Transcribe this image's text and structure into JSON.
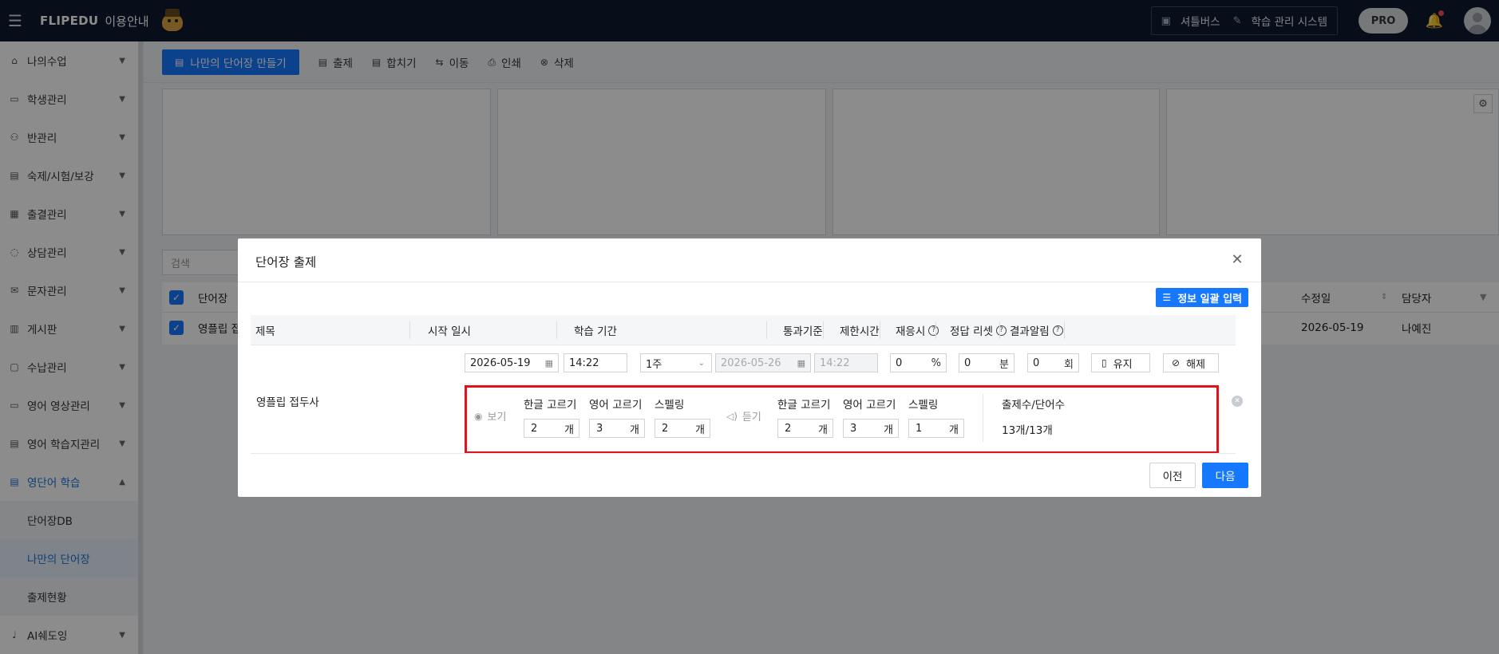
{
  "topbar": {
    "brand": "FLIPEDU",
    "brand_sub": "이용안내",
    "shuttle_label": "셔틀버스",
    "lms_label": "학습 관리 시스템",
    "pro_label": "PRO"
  },
  "sidebar": {
    "items": [
      {
        "label": "나의수업"
      },
      {
        "label": "학생관리"
      },
      {
        "label": "반관리"
      },
      {
        "label": "숙제/시험/보강"
      },
      {
        "label": "출결관리"
      },
      {
        "label": "상담관리"
      },
      {
        "label": "문자관리"
      },
      {
        "label": "게시판"
      },
      {
        "label": "수납관리"
      },
      {
        "label": "영어 영상관리"
      },
      {
        "label": "영어 학습지관리"
      },
      {
        "label": "영단어 학습"
      },
      {
        "label": "AI쉐도잉"
      }
    ],
    "sub_items": [
      {
        "label": "단어장DB"
      },
      {
        "label": "나만의 단어장"
      },
      {
        "label": "출제현황"
      }
    ]
  },
  "toolbar": {
    "create_label": "나만의 단어장 만들기",
    "assign_label": "출제",
    "merge_label": "합치기",
    "move_label": "이동",
    "print_label": "인쇄",
    "delete_label": "삭제"
  },
  "background": {
    "search_placeholder": "검색",
    "col_wordbook": "단어장",
    "col_modified": "수정일",
    "col_manager": "담당자",
    "row_title": "영플립 접",
    "row_modified": "2026-05-19",
    "row_manager": "나예진"
  },
  "modal": {
    "title": "단어장 출제",
    "bulk_label": "정보 일괄 입력",
    "headers": {
      "title": "제목",
      "start": "시작 일시",
      "period": "학습 기간",
      "pass": "통과기준",
      "limit": "제한시간",
      "retry": "재응시",
      "reset": "정답 리셋",
      "notify": "결과알림"
    },
    "controls": {
      "start_date": "2026-05-19",
      "start_time": "14:22",
      "period": "1주",
      "end_date": "2026-05-26",
      "end_time": "14:22",
      "pass_value": "0",
      "pass_unit": "%",
      "limit_value": "0",
      "limit_unit": "분",
      "retry_value": "0",
      "retry_unit": "회",
      "reset_label": "유지",
      "notify_label": "해제"
    },
    "row": {
      "title": "영플립 접두사",
      "see_label": "보기",
      "hear_label": "듣기",
      "see_cols": [
        {
          "label": "한글 고르기",
          "value": "2",
          "unit": "개"
        },
        {
          "label": "영어 고르기",
          "value": "3",
          "unit": "개"
        },
        {
          "label": "스펠링",
          "value": "2",
          "unit": "개"
        }
      ],
      "hear_cols": [
        {
          "label": "한글 고르기",
          "value": "2",
          "unit": "개"
        },
        {
          "label": "영어 고르기",
          "value": "3",
          "unit": "개"
        },
        {
          "label": "스펠링",
          "value": "1",
          "unit": "개"
        }
      ],
      "count_label": "출제수/단어수",
      "count_value": "13개/13개"
    },
    "prev_label": "이전",
    "next_label": "다음"
  },
  "colors": {
    "accent": "#1677ff",
    "topbar": "#0f1a2e",
    "highlight_border": "#e0121c"
  }
}
